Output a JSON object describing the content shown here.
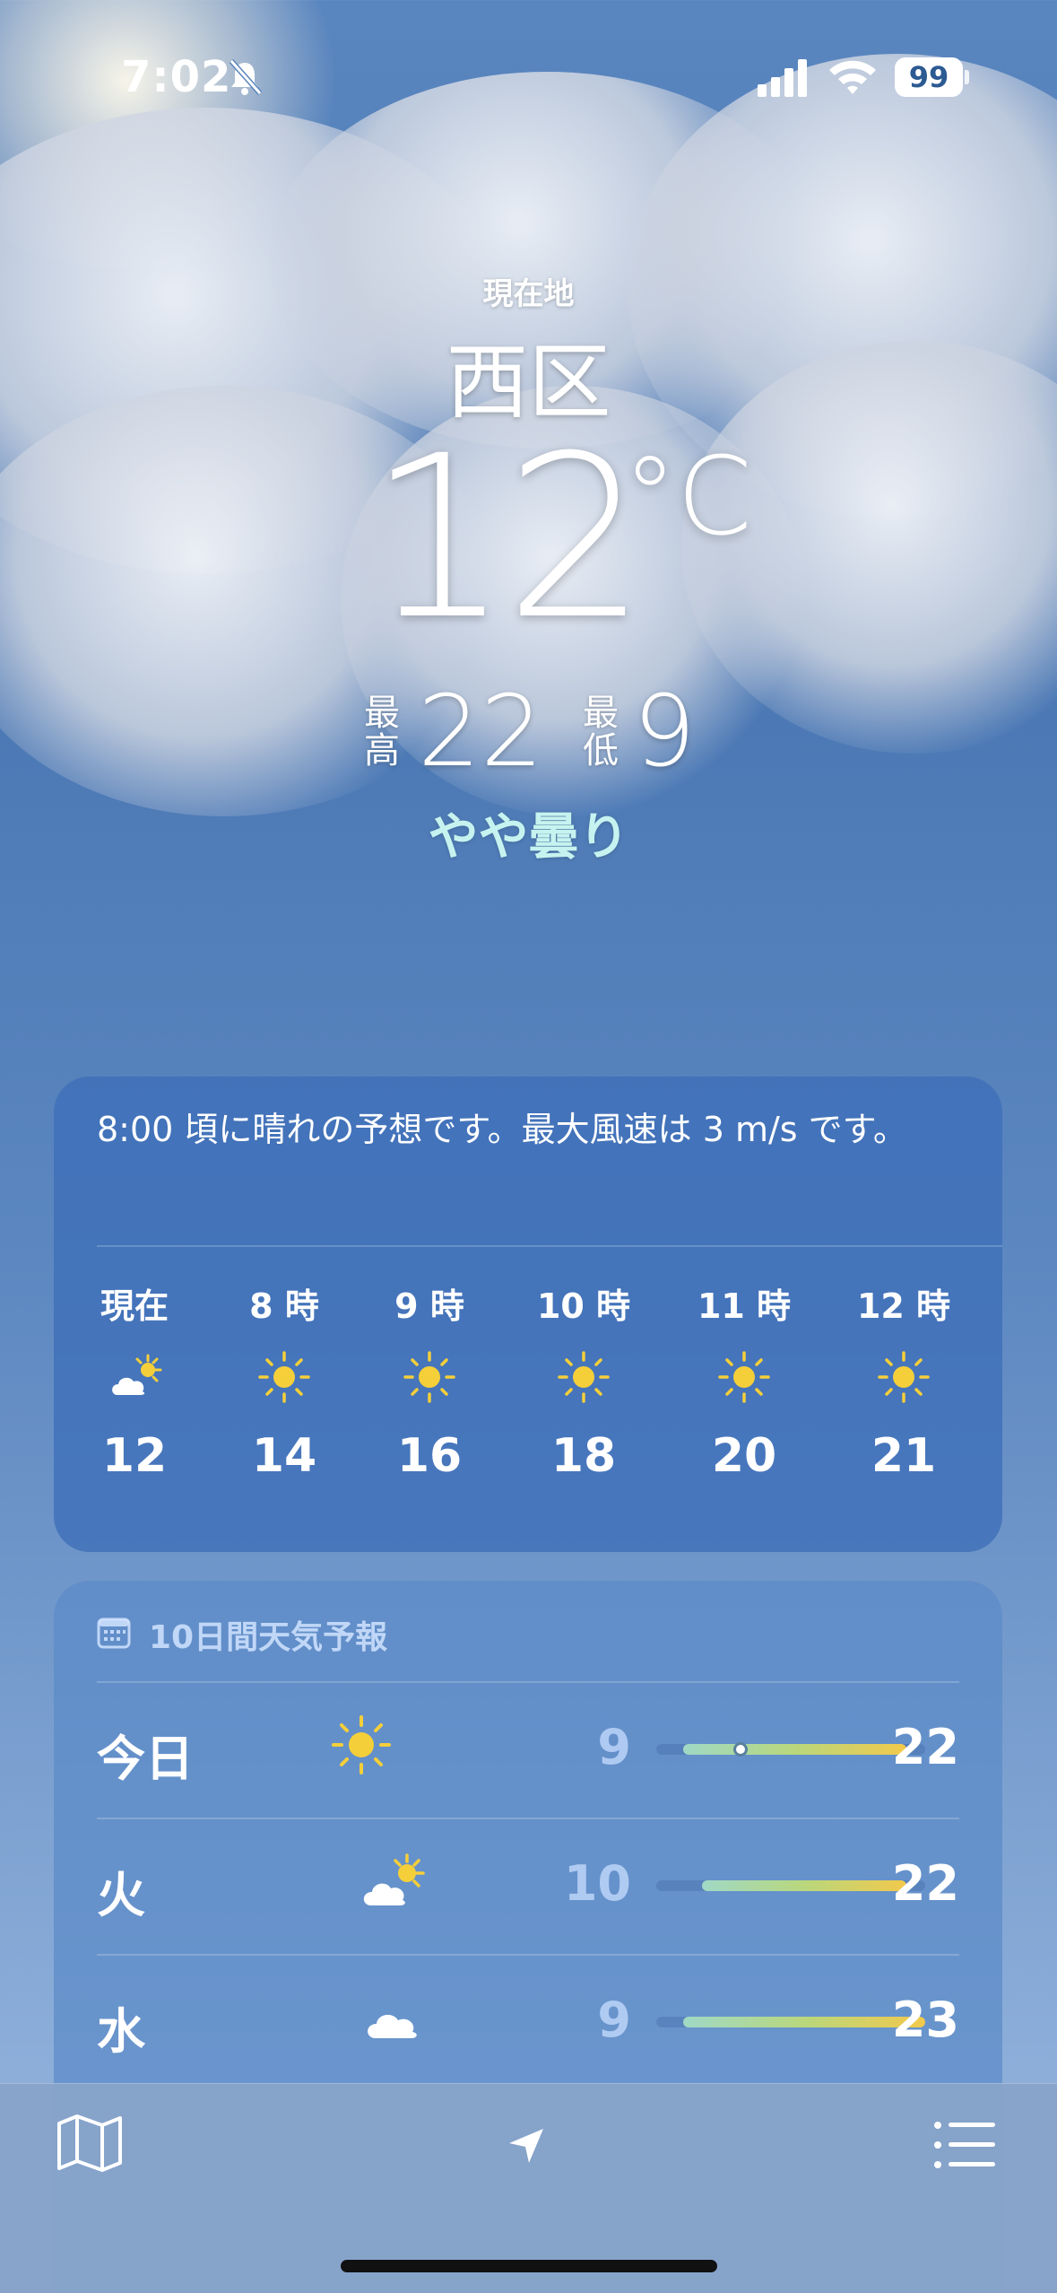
{
  "status_bar": {
    "time": "7:02",
    "battery": "99",
    "icons": [
      "bell-slash-icon",
      "cellular-signal-icon",
      "wifi-icon",
      "battery-icon"
    ]
  },
  "header": {
    "location_label": "現在地",
    "city": "西区",
    "temperature": "12",
    "unit": "°C",
    "high_label": "最高",
    "high": "22",
    "low_label": "最低",
    "low": "9",
    "condition": "やや曇り"
  },
  "hourly": {
    "summary": "8:00 頃に晴れの予想です。最大風速は 3 m/s です。",
    "items": [
      {
        "time": "現在",
        "icon": "partly-cloudy-icon",
        "temp": "12"
      },
      {
        "time": "8 時",
        "icon": "sun-icon",
        "temp": "14"
      },
      {
        "time": "9 時",
        "icon": "sun-icon",
        "temp": "16"
      },
      {
        "time": "10 時",
        "icon": "sun-icon",
        "temp": "18"
      },
      {
        "time": "11 時",
        "icon": "sun-icon",
        "temp": "20"
      },
      {
        "time": "12 時",
        "icon": "sun-icon",
        "temp": "21"
      }
    ]
  },
  "daily": {
    "title": "10日間天気予報",
    "icon": "calendar-icon",
    "range_min": 9,
    "range_max": 23,
    "days": [
      {
        "day": "今日",
        "icon": "sun-icon",
        "low": "9",
        "high": "22",
        "current": 12
      },
      {
        "day": "火",
        "icon": "partly-cloudy-icon",
        "low": "10",
        "high": "22"
      },
      {
        "day": "水",
        "icon": "cloud-icon",
        "low": "9",
        "high": "23"
      }
    ]
  },
  "toolbar": {
    "items": [
      "map-icon",
      "location-arrow-icon",
      "list-icon"
    ]
  },
  "colors": {
    "condition_text": "#c6f3ef",
    "sun": "#f5cf3a",
    "range_start": "#9fd9c6",
    "range_end": "#f2c94c"
  }
}
